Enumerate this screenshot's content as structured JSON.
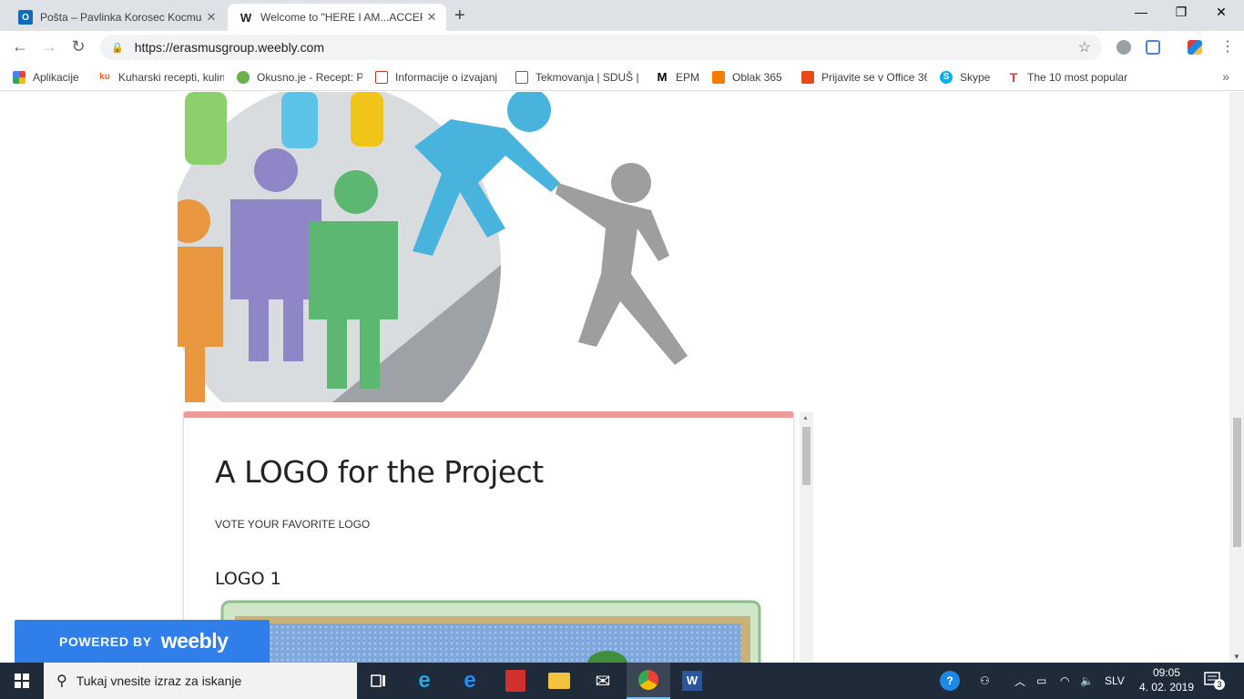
{
  "browser": {
    "tabs": [
      {
        "title": "Pošta – Pavlinka Korosec Kocmur",
        "favicon": "outlook-icon",
        "active": false
      },
      {
        "title": "Welcome to \"HERE I AM...ACCEPT ME",
        "favicon": "weebly-icon",
        "active": true
      }
    ],
    "new_tab": "+",
    "window_controls": {
      "minimize": "—",
      "restore": "❐",
      "close": "✕"
    },
    "address": "https://erasmusgroup.weebly.com",
    "bookmarks": [
      {
        "label": "Aplikacije",
        "icon": "apps-grid-icon"
      },
      {
        "label": "Kuharski recepti, kulin",
        "icon": "kul-icon"
      },
      {
        "label": "Okusno.je - Recept: P",
        "icon": "okusno-icon"
      },
      {
        "label": "Informacije o izvajanj",
        "icon": "info-icon"
      },
      {
        "label": "Tekmovanja | SDUŠ |",
        "icon": "page-icon"
      },
      {
        "label": "EPM",
        "icon": "epm-icon"
      },
      {
        "label": "Oblak 365",
        "icon": "oblak-icon"
      },
      {
        "label": "Prijavite se v Office 36",
        "icon": "office-icon"
      },
      {
        "label": "Skype",
        "icon": "skype-icon"
      },
      {
        "label": "The 10 most popular",
        "icon": "t-icon"
      }
    ],
    "bookmarks_more": "»"
  },
  "page": {
    "card": {
      "title": "A LOGO for the Project",
      "subtitle": "VOTE YOUR FAVORITE LOGO",
      "item_heading": "LOGO 1"
    },
    "weebly_badge": {
      "powered_by": "POWERED BY",
      "brand": "weebly"
    }
  },
  "taskbar": {
    "search_placeholder": "Tukaj vnesite izraz za iskanje",
    "language": "SLV",
    "time": "09:05",
    "date": "4. 02. 2019",
    "notifications": "3"
  },
  "colors": {
    "card_accent": "#ef9a9a",
    "weebly_blue": "#2f7ee9",
    "taskbar": "#1f2b38"
  }
}
